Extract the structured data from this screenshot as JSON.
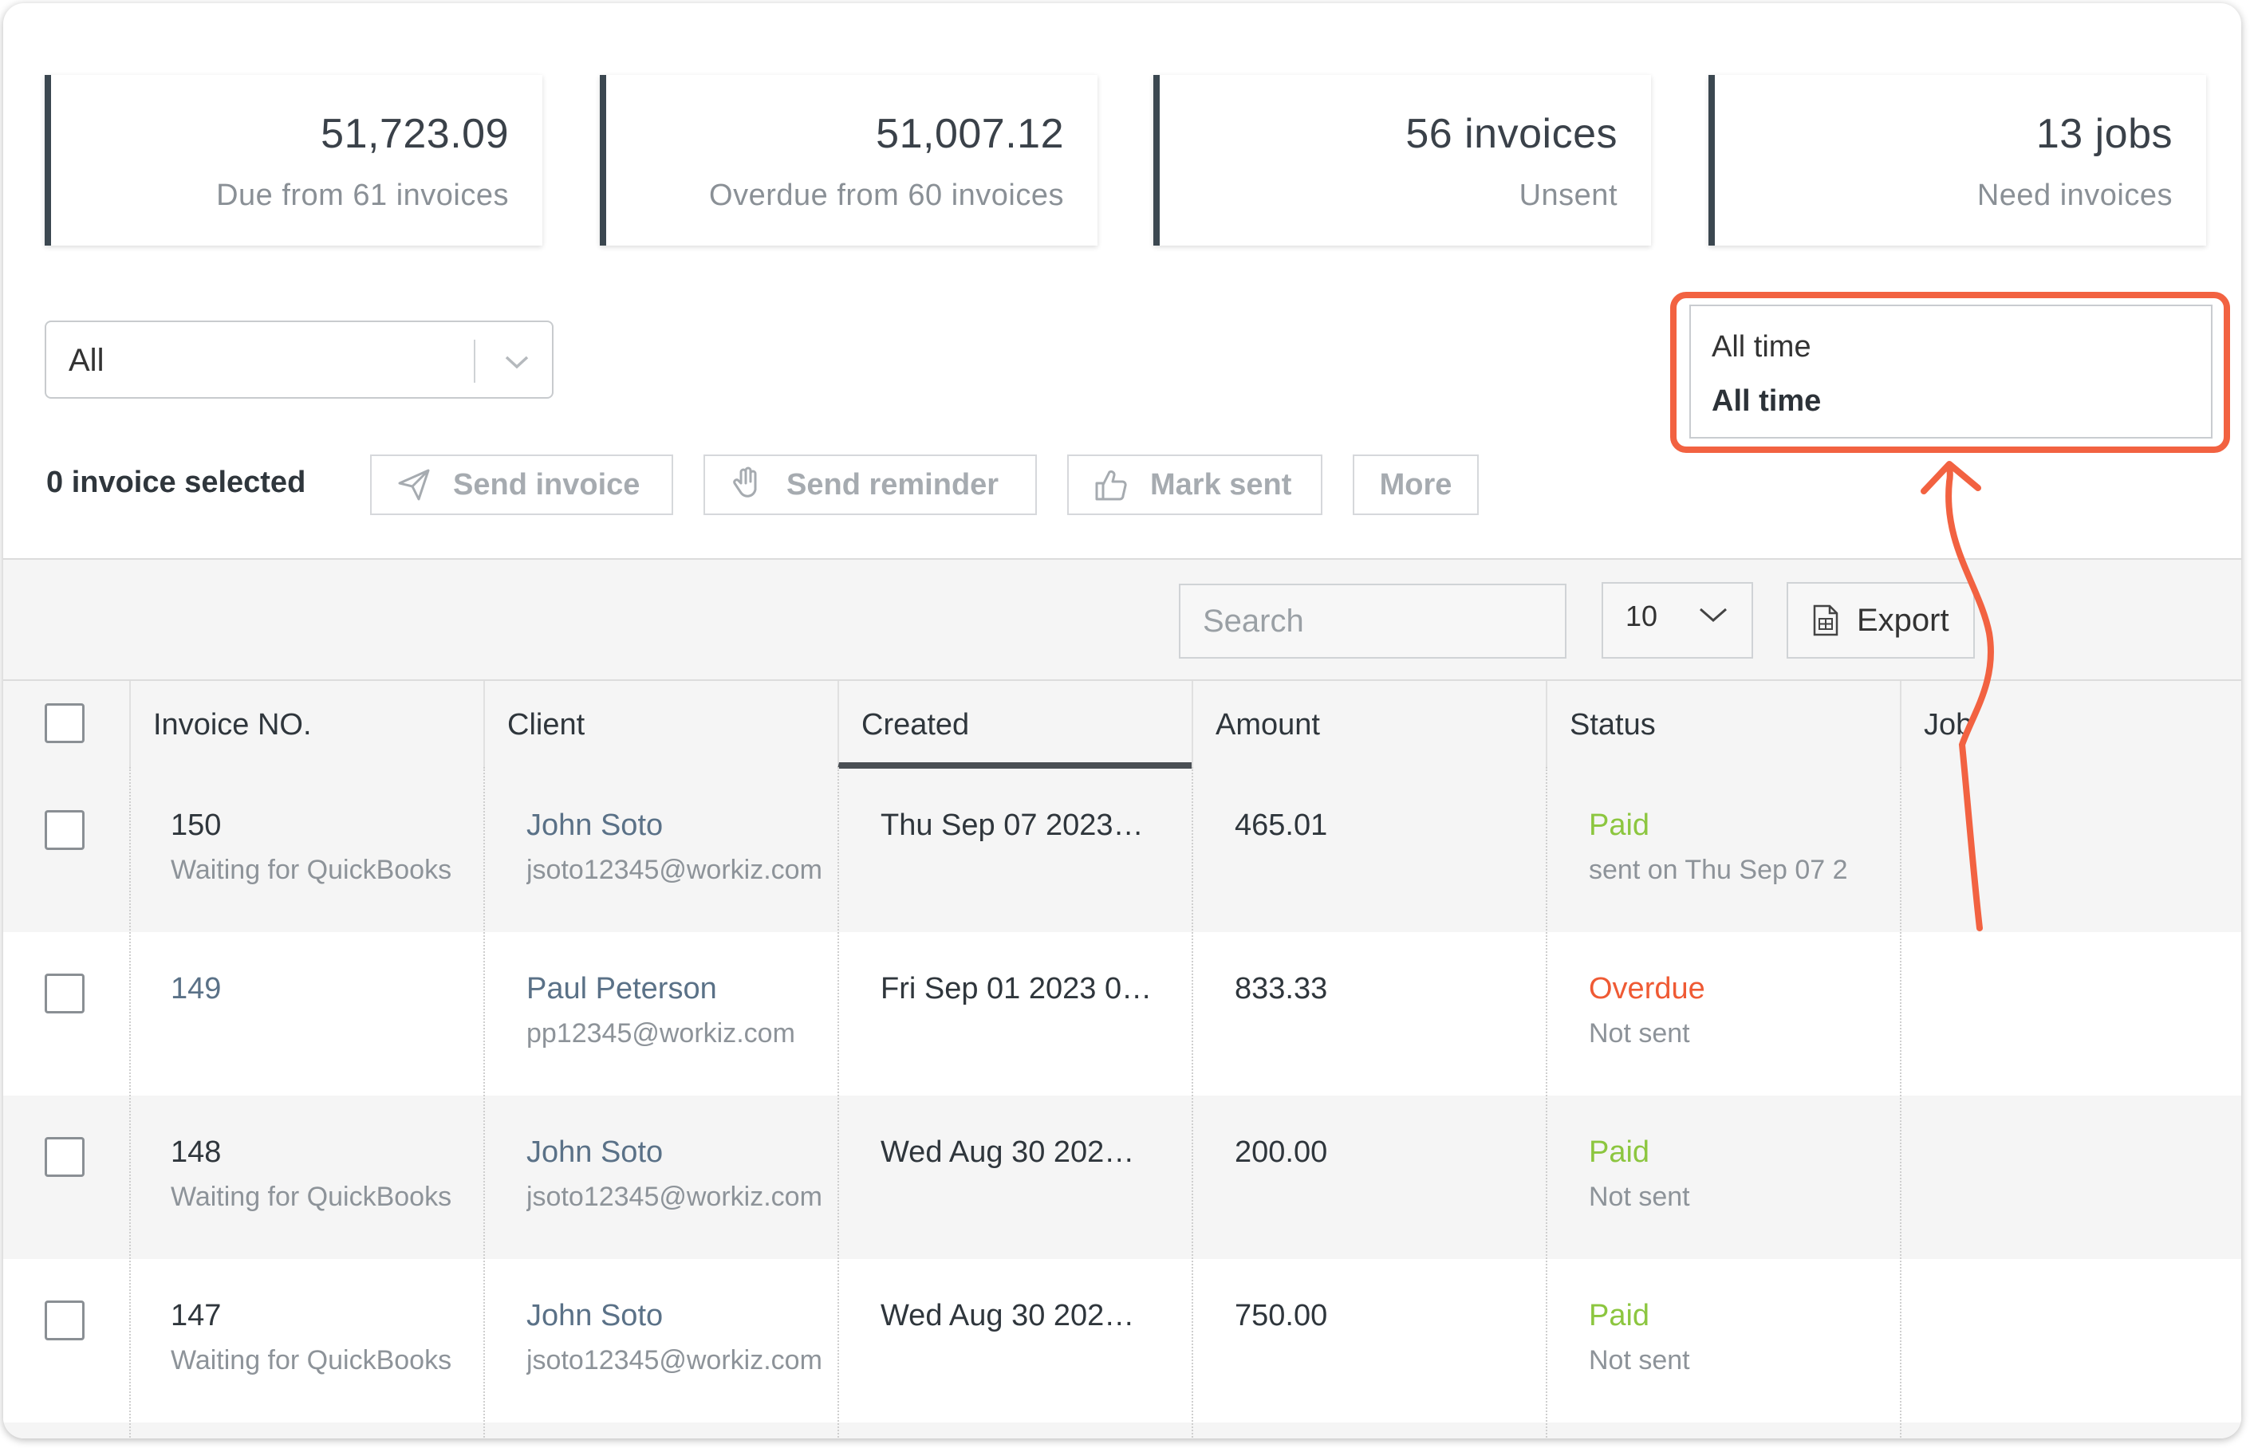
{
  "summary_cards": [
    {
      "value": "51,723.09",
      "label": "Due from 61 invoices"
    },
    {
      "value": "51,007.12",
      "label": "Overdue from 60 invoices"
    },
    {
      "value": "56 invoices",
      "label": "Unsent"
    },
    {
      "value": "13 jobs",
      "label": "Need invoices"
    }
  ],
  "filter": {
    "value": "All"
  },
  "date_filter": {
    "current": "All time",
    "option": "All time"
  },
  "actions": {
    "selected_count": "0 invoice selected",
    "send_invoice": "Send invoice",
    "send_reminder": "Send reminder",
    "mark_sent": "Mark sent",
    "more": "More"
  },
  "table_toolbar": {
    "search_placeholder": "Search",
    "per_page": "10",
    "export": "Export"
  },
  "columns": [
    "Invoice NO.",
    "Client",
    "Created",
    "Amount",
    "Status",
    "Job"
  ],
  "rows": [
    {
      "no": "150",
      "no_sub": "Waiting for QuickBooks",
      "client": "John Soto",
      "email": "jsoto12345@workiz.com",
      "created": "Thu Sep 07 2023…",
      "amount": "465.01",
      "status": "Paid",
      "status_sub": "sent on Thu Sep 07 2"
    },
    {
      "no": "149",
      "no_sub": "",
      "client": "Paul Peterson",
      "email": "pp12345@workiz.com",
      "created": "Fri Sep 01 2023 0…",
      "amount": "833.33",
      "status": "Overdue",
      "status_sub": "Not sent"
    },
    {
      "no": "148",
      "no_sub": "Waiting for QuickBooks",
      "client": "John Soto",
      "email": "jsoto12345@workiz.com",
      "created": "Wed Aug 30 202…",
      "amount": "200.00",
      "status": "Paid",
      "status_sub": "Not sent"
    },
    {
      "no": "147",
      "no_sub": "Waiting for QuickBooks",
      "client": "John Soto",
      "email": "jsoto12345@workiz.com",
      "created": "Wed Aug 30 202…",
      "amount": "750.00",
      "status": "Paid",
      "status_sub": "Not sent"
    }
  ],
  "colors": {
    "paid": "#8cc63f",
    "overdue": "#ef5a34",
    "link": "#5a7187",
    "annotation": "#f26241",
    "card_accent": "#3b4750"
  }
}
